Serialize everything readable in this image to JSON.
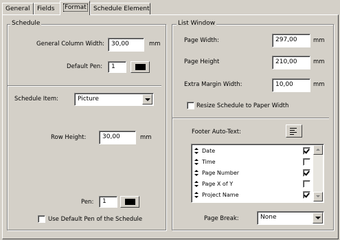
{
  "tabs": [
    {
      "label": "General"
    },
    {
      "label": "Fields"
    },
    {
      "label": "Format"
    },
    {
      "label": "Schedule Element"
    }
  ],
  "schedule": {
    "legend": "Schedule",
    "general_column_width_label": "General Column Width:",
    "general_column_width_value": "30,00",
    "unit_mm": "mm",
    "default_pen_label": "Default Pen:",
    "default_pen_value": "1",
    "schedule_item_label": "Schedule Item:",
    "schedule_item_value": "Picture",
    "row_height_label": "Row Height:",
    "row_height_value": "30,00",
    "pen_label": "Pen:",
    "pen_value": "1",
    "use_default_pen_label": "Use Default Pen of the Schedule",
    "use_default_pen_checked": false
  },
  "list_window": {
    "legend": "List Window",
    "page_width_label": "Page Width:",
    "page_width_value": "297,00",
    "page_height_label": "Page Height",
    "page_height_value": "210,00",
    "extra_margin_label": "Extra Margin Width:",
    "extra_margin_value": "10,00",
    "unit_mm": "mm",
    "resize_label": "Resize Schedule to Paper Width",
    "resize_checked": false,
    "footer_label": "Footer Auto-Text:",
    "footer_items": [
      {
        "label": "Date",
        "checked": true
      },
      {
        "label": "Time",
        "checked": false
      },
      {
        "label": "Page Number",
        "checked": true
      },
      {
        "label": "Page X of Y",
        "checked": false
      },
      {
        "label": "Project Name",
        "checked": true
      }
    ],
    "page_break_label": "Page Break:",
    "page_break_value": "None"
  }
}
